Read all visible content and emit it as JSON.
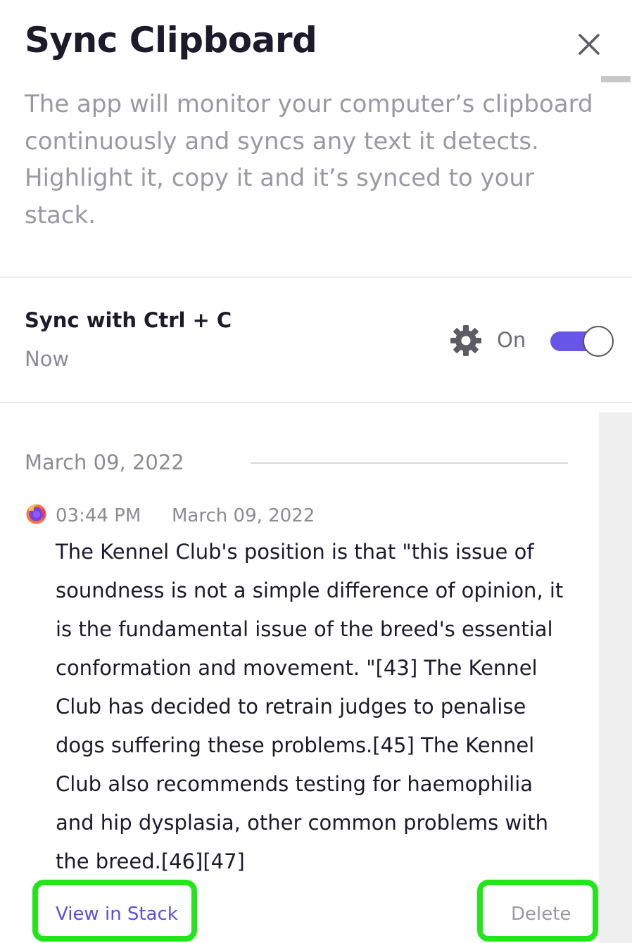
{
  "panel": {
    "title": "Sync Clipboard",
    "close_icon": "close-icon",
    "description": "The app will monitor your computer’s clipboard continuously and syncs any text it detects. Highlight it, copy it and it’s synced to your stack."
  },
  "sync": {
    "title": "Sync with Ctrl + C",
    "subtitle": "Now",
    "settings_icon": "gear-icon",
    "status_label": "On",
    "toggle_on": true,
    "accent_color": "#6655e8"
  },
  "history": {
    "date_header": "March 09, 2022",
    "items": [
      {
        "source_icon": "firefox-icon",
        "time": "03:44 PM",
        "date": "March 09, 2022",
        "text": "The Kennel Club's position is that \"this issue of soundness is not a simple difference of opinion, it is the fundamental issue of the breed's essential conformation and movement. \"[43] The Kennel Club has decided to retrain judges to penalise dogs suffering these problems.[45] The Kennel Club also recommends testing for haemophilia and hip dysplasia, other common problems with the breed.[46][47]",
        "view_label": "View in Stack",
        "delete_label": "Delete"
      }
    ]
  },
  "colors": {
    "highlight_outline": "#22e61a",
    "link": "#5b4fe0"
  }
}
